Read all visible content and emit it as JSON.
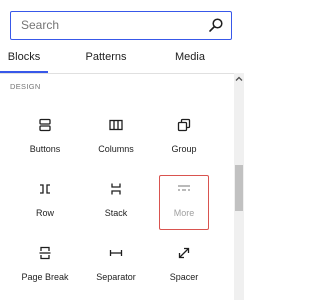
{
  "search": {
    "placeholder": "Search"
  },
  "tabs": [
    {
      "label": "Blocks",
      "active": true
    },
    {
      "label": "Patterns",
      "active": false
    },
    {
      "label": "Media",
      "active": false
    }
  ],
  "section": {
    "title": "DESIGN"
  },
  "blocks": [
    {
      "label": "Buttons",
      "icon": "buttons-icon"
    },
    {
      "label": "Columns",
      "icon": "columns-icon"
    },
    {
      "label": "Group",
      "icon": "group-icon"
    },
    {
      "label": "Row",
      "icon": "row-icon"
    },
    {
      "label": "Stack",
      "icon": "stack-icon"
    },
    {
      "label": "More",
      "icon": "more-icon",
      "disabled": true,
      "highlighted": true
    },
    {
      "label": "Page Break",
      "icon": "page-break-icon"
    },
    {
      "label": "Separator",
      "icon": "separator-icon"
    },
    {
      "label": "Spacer",
      "icon": "spacer-icon"
    }
  ],
  "colors": {
    "accent": "#3858e9",
    "highlight": "#d9534f",
    "text": "#1e1e1e",
    "muted": "#757575"
  }
}
